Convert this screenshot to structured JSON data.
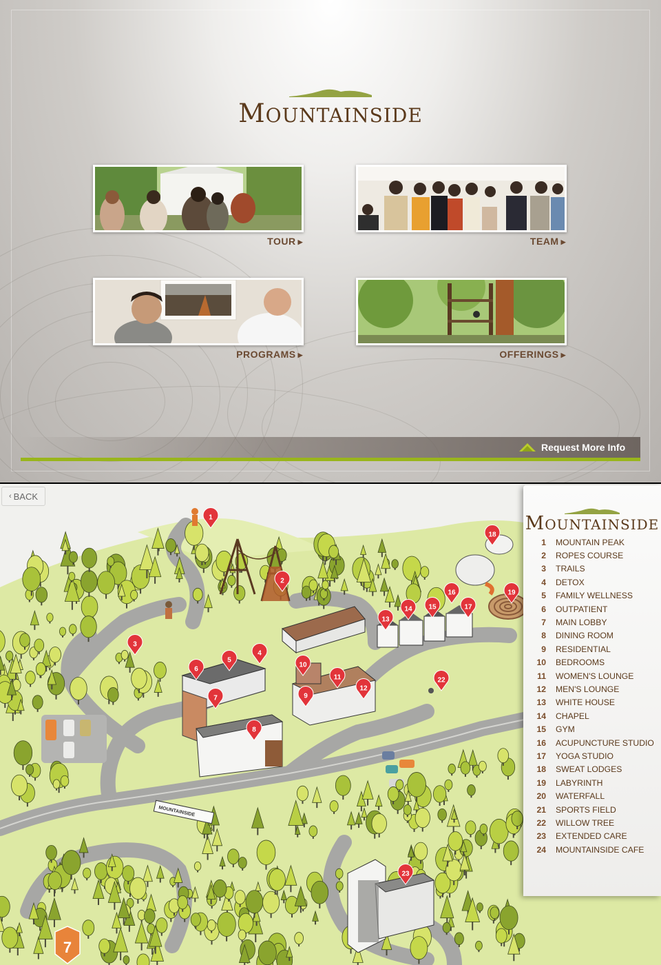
{
  "home": {
    "logo": {
      "first": "M",
      "rest": "OUNTAINSIDE"
    },
    "tiles": [
      {
        "label": "TOUR"
      },
      {
        "label": "TEAM"
      },
      {
        "label": "PROGRAMS"
      },
      {
        "label": "OFFERINGS"
      }
    ],
    "arrow_glyph": "▶",
    "request_info": {
      "label": "Request More Info",
      "icon": "mountain-icon"
    },
    "colors": {
      "accent_green": "#99b51c",
      "brand_brown": "#5b3a1c"
    }
  },
  "map": {
    "back_label": "BACK",
    "back_icon": "chevron-left-icon",
    "legend_logo": {
      "first": "M",
      "rest": "OUNTAINSIDE"
    },
    "sign_text": "MOUNTAINSIDE",
    "badge_number": "7",
    "pin_color": "#e2343a",
    "locations": [
      {
        "num": "1",
        "name": "Mountain Peak"
      },
      {
        "num": "2",
        "name": "Ropes Course"
      },
      {
        "num": "3",
        "name": "Trails"
      },
      {
        "num": "4",
        "name": "Detox"
      },
      {
        "num": "5",
        "name": "Family Wellness"
      },
      {
        "num": "6",
        "name": "Outpatient"
      },
      {
        "num": "7",
        "name": "Main Lobby"
      },
      {
        "num": "8",
        "name": "Dining Room"
      },
      {
        "num": "9",
        "name": "Residential"
      },
      {
        "num": "10",
        "name": "Bedrooms"
      },
      {
        "num": "11",
        "name": "Women's Lounge"
      },
      {
        "num": "12",
        "name": "Men's Lounge"
      },
      {
        "num": "13",
        "name": "White House"
      },
      {
        "num": "14",
        "name": "Chapel"
      },
      {
        "num": "15",
        "name": "Gym"
      },
      {
        "num": "16",
        "name": "Acupuncture Studio"
      },
      {
        "num": "17",
        "name": "Yoga Studio"
      },
      {
        "num": "18",
        "name": "Sweat Lodges"
      },
      {
        "num": "19",
        "name": "Labyrinth"
      },
      {
        "num": "20",
        "name": "Waterfall"
      },
      {
        "num": "21",
        "name": "Sports Field"
      },
      {
        "num": "22",
        "name": "Willow Tree"
      },
      {
        "num": "23",
        "name": "Extended Care"
      },
      {
        "num": "24",
        "name": "Mountainside Cafe"
      }
    ]
  }
}
